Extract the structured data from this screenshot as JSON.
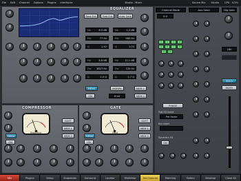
{
  "menubar": {
    "items": [
      "File",
      "Edit",
      "Channel",
      "Options",
      "Plugins",
      "Interfaces"
    ],
    "status_left": "Studio - Mixer",
    "status_mid": "Source Mix",
    "status_right_1": "Studio",
    "status_right_2": "CPU - 4.5%"
  },
  "equalizer": {
    "title": "EQUALIZER",
    "top_buttons": [
      "Bass Ext",
      "Treb Ext",
      "Auto Gain"
    ],
    "menu_label": "MENU",
    "morph_label": "MORPH",
    "mem_labels": [
      "MEM 1",
      "MEM 2"
    ],
    "on_label": "ON",
    "value_8bit": "8 bit",
    "readouts": [
      {
        "k": "Hz",
        "v": "6.5 dB"
      },
      {
        "k": "Hz",
        "v": "1.2 dB"
      },
      {
        "k": "Fre",
        "v": "77 Hz"
      },
      {
        "k": "Fre",
        "v": "985 Hz"
      },
      {
        "k": "Q",
        "v": "1.42"
      },
      {
        "k": "Q",
        "v": "1.03"
      },
      {
        "k": "Hz",
        "v": "4.8 dB"
      },
      {
        "k": "Hz",
        "v": "11.1 dB"
      },
      {
        "k": "Fre",
        "v": "3827 Hz"
      },
      {
        "k": "Fre",
        "v": "12k Hz"
      },
      {
        "k": "Q",
        "v": "1.0 Q"
      },
      {
        "k": "Q",
        "v": "1.7 Q"
      }
    ]
  },
  "compressor": {
    "title": "COMPRESSOR",
    "buttons": [
      "SOFT",
      "MEM 1",
      "MEM 2",
      "MENU",
      "ON"
    ],
    "meter_label": "Reduction"
  },
  "gate": {
    "title": "GATE",
    "buttons": [
      "SOFT",
      "MEM 1",
      "MEM 2",
      "MENU",
      "ON"
    ],
    "meter_label": "Input"
  },
  "channel": {
    "header_left": "Channel Mode",
    "header_right": "Aux Send",
    "phase_label": "PHASE",
    "post_eq_label": "Post EQ Insert",
    "pre_fader_label": "Pre Fader",
    "bus_label": "Bus Insert",
    "dynamics_label": "Dynamics EQ",
    "on_label": "ON",
    "small_readout": "0.0",
    "solo_label": "SOLO",
    "mute_label": "MUTE",
    "gain_label": "Dig Gain",
    "value_16k": "16k",
    "grid_labels": [
      "1",
      "2",
      "3",
      "4",
      "5",
      "6",
      "7",
      "8",
      "9",
      "10"
    ]
  },
  "tabs": {
    "items": [
      "Mix",
      "Plugins",
      "Setup",
      "Snapshots",
      "Surround",
      "Locator",
      "MixEditor",
      "Fat Channel",
      "Patching",
      "Faders",
      "Desktop",
      "Close All"
    ]
  },
  "colors": {
    "accent_tab": "#e5c440",
    "eq_screen": "#1b2c76",
    "eq_curve": "#9fd0ff"
  }
}
